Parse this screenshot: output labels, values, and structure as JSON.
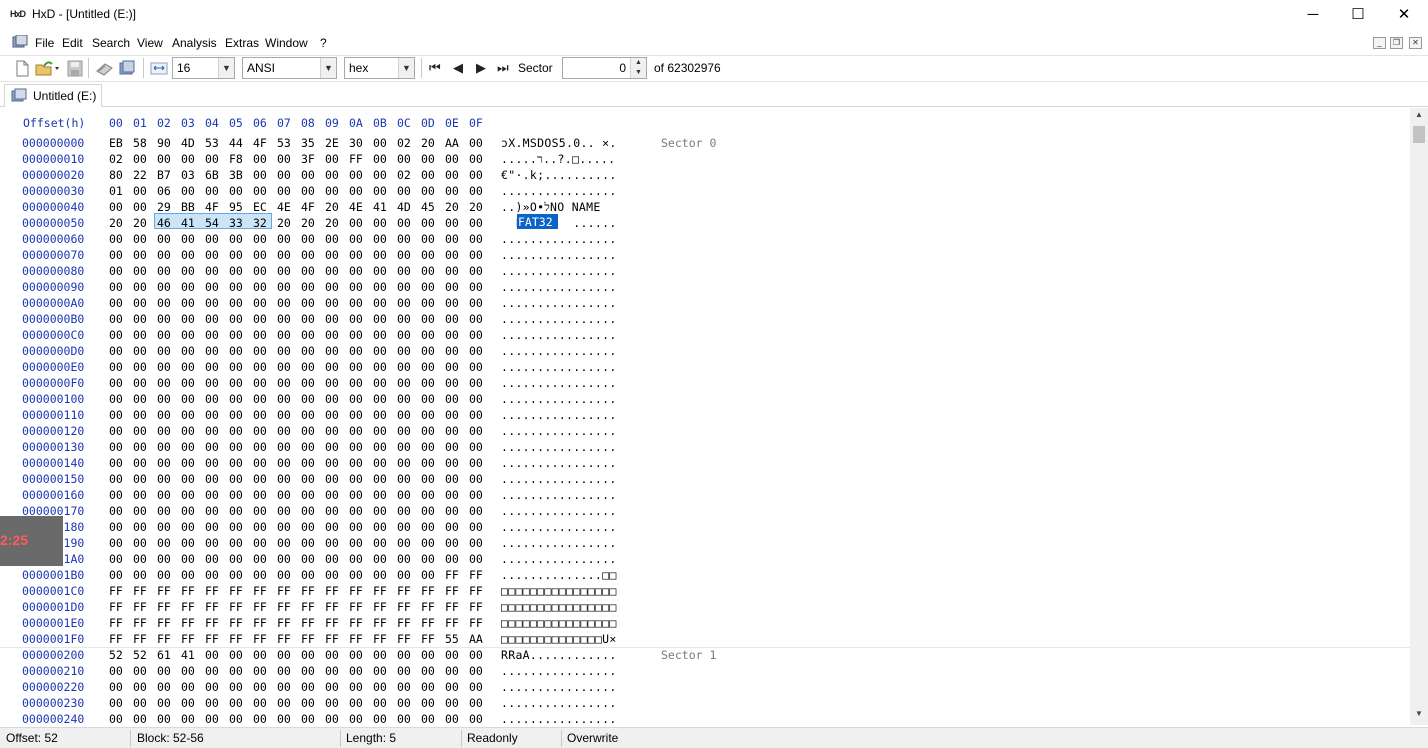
{
  "window": {
    "title": "HxD - [Untitled (E:)]",
    "app_icon": "HxD",
    "minimize": "─",
    "maximize": "☐",
    "close": "✕"
  },
  "menu": [
    "File",
    "Edit",
    "Search",
    "View",
    "Analysis",
    "Extras",
    "Window",
    "?"
  ],
  "toolbar": {
    "bytes_per_row": "16",
    "charset": "ANSI",
    "offset_base": "hex",
    "sector_label": "Sector",
    "sector_value": "0",
    "sector_total": "of 62302976"
  },
  "tab": {
    "label": "Untitled (E:)"
  },
  "editor": {
    "offset_header": "Offset(h)",
    "columns": [
      "00",
      "01",
      "02",
      "03",
      "04",
      "05",
      "06",
      "07",
      "08",
      "09",
      "0A",
      "0B",
      "0C",
      "0D",
      "0E",
      "0F"
    ],
    "rows": [
      {
        "off": "000000000",
        "hex": [
          "EB",
          "58",
          "90",
          "4D",
          "53",
          "44",
          "4F",
          "53",
          "35",
          "2E",
          "30",
          "00",
          "02",
          "20",
          "AA",
          "00"
        ],
        "ascii": "ɔX.MSDOS5.0.. ×.",
        "sector": "Sector 0"
      },
      {
        "off": "000000010",
        "hex": [
          "02",
          "00",
          "00",
          "00",
          "00",
          "F8",
          "00",
          "00",
          "3F",
          "00",
          "FF",
          "00",
          "00",
          "00",
          "00",
          "00"
        ],
        "ascii": ".....ר..?.□....."
      },
      {
        "off": "000000020",
        "hex": [
          "80",
          "22",
          "B7",
          "03",
          "6B",
          "3B",
          "00",
          "00",
          "00",
          "00",
          "00",
          "00",
          "02",
          "00",
          "00",
          "00"
        ],
        "ascii": "€\"·.k;.........."
      },
      {
        "off": "000000030",
        "hex": [
          "01",
          "00",
          "06",
          "00",
          "00",
          "00",
          "00",
          "00",
          "00",
          "00",
          "00",
          "00",
          "00",
          "00",
          "00",
          "00"
        ],
        "ascii": "................"
      },
      {
        "off": "000000040",
        "hex": [
          "00",
          "00",
          "29",
          "BB",
          "4F",
          "95",
          "EC",
          "4E",
          "4F",
          "20",
          "4E",
          "41",
          "4D",
          "45",
          "20",
          "20"
        ],
        "ascii": "..)»O•לNO NAME  "
      },
      {
        "off": "000000050",
        "hex": [
          "20",
          "20",
          "46",
          "41",
          "54",
          "33",
          "32",
          "20",
          "20",
          "20",
          "00",
          "00",
          "00",
          "00",
          "00",
          "00"
        ],
        "ascii": "  FAT32   ......"
      },
      {
        "off": "000000060",
        "hex": [
          "00",
          "00",
          "00",
          "00",
          "00",
          "00",
          "00",
          "00",
          "00",
          "00",
          "00",
          "00",
          "00",
          "00",
          "00",
          "00"
        ],
        "ascii": "................"
      },
      {
        "off": "000000070",
        "hex": [
          "00",
          "00",
          "00",
          "00",
          "00",
          "00",
          "00",
          "00",
          "00",
          "00",
          "00",
          "00",
          "00",
          "00",
          "00",
          "00"
        ],
        "ascii": "................"
      },
      {
        "off": "000000080",
        "hex": [
          "00",
          "00",
          "00",
          "00",
          "00",
          "00",
          "00",
          "00",
          "00",
          "00",
          "00",
          "00",
          "00",
          "00",
          "00",
          "00"
        ],
        "ascii": "................"
      },
      {
        "off": "000000090",
        "hex": [
          "00",
          "00",
          "00",
          "00",
          "00",
          "00",
          "00",
          "00",
          "00",
          "00",
          "00",
          "00",
          "00",
          "00",
          "00",
          "00"
        ],
        "ascii": "................"
      },
      {
        "off": "0000000A0",
        "hex": [
          "00",
          "00",
          "00",
          "00",
          "00",
          "00",
          "00",
          "00",
          "00",
          "00",
          "00",
          "00",
          "00",
          "00",
          "00",
          "00"
        ],
        "ascii": "................"
      },
      {
        "off": "0000000B0",
        "hex": [
          "00",
          "00",
          "00",
          "00",
          "00",
          "00",
          "00",
          "00",
          "00",
          "00",
          "00",
          "00",
          "00",
          "00",
          "00",
          "00"
        ],
        "ascii": "................"
      },
      {
        "off": "0000000C0",
        "hex": [
          "00",
          "00",
          "00",
          "00",
          "00",
          "00",
          "00",
          "00",
          "00",
          "00",
          "00",
          "00",
          "00",
          "00",
          "00",
          "00"
        ],
        "ascii": "................"
      },
      {
        "off": "0000000D0",
        "hex": [
          "00",
          "00",
          "00",
          "00",
          "00",
          "00",
          "00",
          "00",
          "00",
          "00",
          "00",
          "00",
          "00",
          "00",
          "00",
          "00"
        ],
        "ascii": "................"
      },
      {
        "off": "0000000E0",
        "hex": [
          "00",
          "00",
          "00",
          "00",
          "00",
          "00",
          "00",
          "00",
          "00",
          "00",
          "00",
          "00",
          "00",
          "00",
          "00",
          "00"
        ],
        "ascii": "................"
      },
      {
        "off": "0000000F0",
        "hex": [
          "00",
          "00",
          "00",
          "00",
          "00",
          "00",
          "00",
          "00",
          "00",
          "00",
          "00",
          "00",
          "00",
          "00",
          "00",
          "00"
        ],
        "ascii": "................"
      },
      {
        "off": "000000100",
        "hex": [
          "00",
          "00",
          "00",
          "00",
          "00",
          "00",
          "00",
          "00",
          "00",
          "00",
          "00",
          "00",
          "00",
          "00",
          "00",
          "00"
        ],
        "ascii": "................"
      },
      {
        "off": "000000110",
        "hex": [
          "00",
          "00",
          "00",
          "00",
          "00",
          "00",
          "00",
          "00",
          "00",
          "00",
          "00",
          "00",
          "00",
          "00",
          "00",
          "00"
        ],
        "ascii": "................"
      },
      {
        "off": "000000120",
        "hex": [
          "00",
          "00",
          "00",
          "00",
          "00",
          "00",
          "00",
          "00",
          "00",
          "00",
          "00",
          "00",
          "00",
          "00",
          "00",
          "00"
        ],
        "ascii": "................"
      },
      {
        "off": "000000130",
        "hex": [
          "00",
          "00",
          "00",
          "00",
          "00",
          "00",
          "00",
          "00",
          "00",
          "00",
          "00",
          "00",
          "00",
          "00",
          "00",
          "00"
        ],
        "ascii": "................"
      },
      {
        "off": "000000140",
        "hex": [
          "00",
          "00",
          "00",
          "00",
          "00",
          "00",
          "00",
          "00",
          "00",
          "00",
          "00",
          "00",
          "00",
          "00",
          "00",
          "00"
        ],
        "ascii": "................"
      },
      {
        "off": "000000150",
        "hex": [
          "00",
          "00",
          "00",
          "00",
          "00",
          "00",
          "00",
          "00",
          "00",
          "00",
          "00",
          "00",
          "00",
          "00",
          "00",
          "00"
        ],
        "ascii": "................"
      },
      {
        "off": "000000160",
        "hex": [
          "00",
          "00",
          "00",
          "00",
          "00",
          "00",
          "00",
          "00",
          "00",
          "00",
          "00",
          "00",
          "00",
          "00",
          "00",
          "00"
        ],
        "ascii": "................"
      },
      {
        "off": "000000170",
        "hex": [
          "00",
          "00",
          "00",
          "00",
          "00",
          "00",
          "00",
          "00",
          "00",
          "00",
          "00",
          "00",
          "00",
          "00",
          "00",
          "00"
        ],
        "ascii": "................"
      },
      {
        "off": "000000180",
        "hex": [
          "00",
          "00",
          "00",
          "00",
          "00",
          "00",
          "00",
          "00",
          "00",
          "00",
          "00",
          "00",
          "00",
          "00",
          "00",
          "00"
        ],
        "ascii": "................"
      },
      {
        "off": "000000190",
        "hex": [
          "00",
          "00",
          "00",
          "00",
          "00",
          "00",
          "00",
          "00",
          "00",
          "00",
          "00",
          "00",
          "00",
          "00",
          "00",
          "00"
        ],
        "ascii": "................"
      },
      {
        "off": "0000001A0",
        "hex": [
          "00",
          "00",
          "00",
          "00",
          "00",
          "00",
          "00",
          "00",
          "00",
          "00",
          "00",
          "00",
          "00",
          "00",
          "00",
          "00"
        ],
        "ascii": "................"
      },
      {
        "off": "0000001B0",
        "hex": [
          "00",
          "00",
          "00",
          "00",
          "00",
          "00",
          "00",
          "00",
          "00",
          "00",
          "00",
          "00",
          "00",
          "00",
          "FF",
          "FF"
        ],
        "ascii": "..............□□"
      },
      {
        "off": "0000001C0",
        "hex": [
          "FF",
          "FF",
          "FF",
          "FF",
          "FF",
          "FF",
          "FF",
          "FF",
          "FF",
          "FF",
          "FF",
          "FF",
          "FF",
          "FF",
          "FF",
          "FF"
        ],
        "ascii": "□□□□□□□□□□□□□□□□"
      },
      {
        "off": "0000001D0",
        "hex": [
          "FF",
          "FF",
          "FF",
          "FF",
          "FF",
          "FF",
          "FF",
          "FF",
          "FF",
          "FF",
          "FF",
          "FF",
          "FF",
          "FF",
          "FF",
          "FF"
        ],
        "ascii": "□□□□□□□□□□□□□□□□"
      },
      {
        "off": "0000001E0",
        "hex": [
          "FF",
          "FF",
          "FF",
          "FF",
          "FF",
          "FF",
          "FF",
          "FF",
          "FF",
          "FF",
          "FF",
          "FF",
          "FF",
          "FF",
          "FF",
          "FF"
        ],
        "ascii": "□□□□□□□□□□□□□□□□"
      },
      {
        "off": "0000001F0",
        "hex": [
          "FF",
          "FF",
          "FF",
          "FF",
          "FF",
          "FF",
          "FF",
          "FF",
          "FF",
          "FF",
          "FF",
          "FF",
          "FF",
          "FF",
          "55",
          "AA"
        ],
        "ascii": "□□□□□□□□□□□□□□U×"
      },
      {
        "off": "000000200",
        "hex": [
          "52",
          "52",
          "61",
          "41",
          "00",
          "00",
          "00",
          "00",
          "00",
          "00",
          "00",
          "00",
          "00",
          "00",
          "00",
          "00"
        ],
        "ascii": "RRaA............",
        "sector": "Sector 1"
      },
      {
        "off": "000000210",
        "hex": [
          "00",
          "00",
          "00",
          "00",
          "00",
          "00",
          "00",
          "00",
          "00",
          "00",
          "00",
          "00",
          "00",
          "00",
          "00",
          "00"
        ],
        "ascii": "................"
      },
      {
        "off": "000000220",
        "hex": [
          "00",
          "00",
          "00",
          "00",
          "00",
          "00",
          "00",
          "00",
          "00",
          "00",
          "00",
          "00",
          "00",
          "00",
          "00",
          "00"
        ],
        "ascii": "................"
      },
      {
        "off": "000000230",
        "hex": [
          "00",
          "00",
          "00",
          "00",
          "00",
          "00",
          "00",
          "00",
          "00",
          "00",
          "00",
          "00",
          "00",
          "00",
          "00",
          "00"
        ],
        "ascii": "................"
      },
      {
        "off": "000000240",
        "hex": [
          "00",
          "00",
          "00",
          "00",
          "00",
          "00",
          "00",
          "00",
          "00",
          "00",
          "00",
          "00",
          "00",
          "00",
          "00",
          "00"
        ],
        "ascii": "................"
      }
    ],
    "selection_ascii": "FAT32"
  },
  "status": {
    "offset": "Offset: 52",
    "block": "Block: 52-56",
    "length": "Length: 5",
    "mode": "Readonly",
    "insert": "Overwrite"
  },
  "overlay": {
    "clock": "2:25"
  },
  "colors": {
    "offset_blue": "#1a36b4",
    "selection": "#0a64c8"
  }
}
